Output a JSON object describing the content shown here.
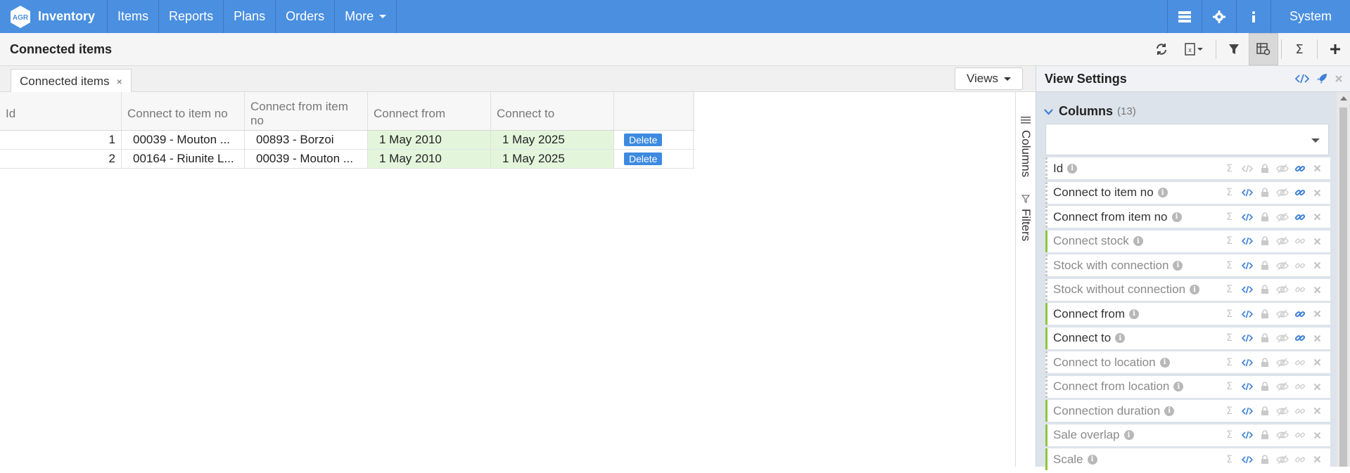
{
  "nav": {
    "brand_logo_text": "AGR",
    "brand_name": "Inventory",
    "items": [
      {
        "label": "Items"
      },
      {
        "label": "Reports"
      },
      {
        "label": "Plans"
      },
      {
        "label": "Orders"
      },
      {
        "label": "More"
      }
    ],
    "system_label": "System"
  },
  "header": {
    "title": "Connected items"
  },
  "tabs": {
    "active_tab": "Connected items",
    "close_glyph": "×",
    "views_label": "Views"
  },
  "grid": {
    "columns": [
      {
        "label": "Id"
      },
      {
        "label": "Connect to item no"
      },
      {
        "label": "Connect from item no"
      },
      {
        "label": "Connect from"
      },
      {
        "label": "Connect to"
      },
      {
        "label": ""
      }
    ],
    "rows": [
      {
        "id": "1",
        "to_item": "00039 - Mouton ...",
        "from_item": "00893 - Borzoi",
        "connect_from": "1 May 2010",
        "connect_to": "1 May 2025",
        "action": "Delete"
      },
      {
        "id": "2",
        "to_item": "00164 - Riunite L...",
        "from_item": "00039 - Mouton ...",
        "connect_from": "1 May 2010",
        "connect_to": "1 May 2025",
        "action": "Delete"
      }
    ]
  },
  "side_strip": {
    "columns_label": "Columns",
    "filters_label": "Filters"
  },
  "view_settings": {
    "title": "View Settings",
    "columns_heading": "Columns",
    "columns_count": "(13)",
    "column_items": [
      {
        "name": "Id",
        "active": true,
        "accent": false,
        "linked": true
      },
      {
        "name": "Connect to item no",
        "active": true,
        "accent": false,
        "linked": true
      },
      {
        "name": "Connect from item no",
        "active": true,
        "accent": false,
        "linked": true
      },
      {
        "name": "Connect stock",
        "active": false,
        "accent": true,
        "linked": false
      },
      {
        "name": "Stock with connection",
        "active": false,
        "accent": false,
        "linked": false
      },
      {
        "name": "Stock without connection",
        "active": false,
        "accent": false,
        "linked": false
      },
      {
        "name": "Connect from",
        "active": true,
        "accent": true,
        "linked": true
      },
      {
        "name": "Connect to",
        "active": true,
        "accent": true,
        "linked": true
      },
      {
        "name": "Connect to location",
        "active": false,
        "accent": false,
        "linked": false
      },
      {
        "name": "Connect from location",
        "active": false,
        "accent": false,
        "linked": false
      },
      {
        "name": "Connection duration",
        "active": false,
        "accent": true,
        "linked": false
      },
      {
        "name": "Sale overlap",
        "active": false,
        "accent": true,
        "linked": false
      },
      {
        "name": "Scale",
        "active": false,
        "accent": true,
        "linked": false
      }
    ]
  },
  "colors": {
    "navbar": "#4a8fe0",
    "accent_green": "#8cc63f",
    "date_cell": "#e3f6dc",
    "link_blue": "#3d7fd8"
  }
}
